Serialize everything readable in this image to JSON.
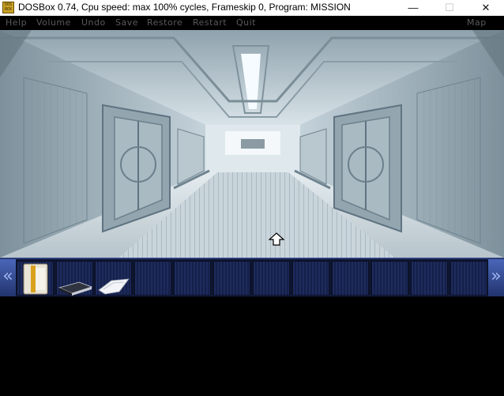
{
  "window": {
    "title": "DOSBox 0.74, Cpu speed: max 100% cycles, Frameskip  0, Program:  MISSION",
    "icon": "dosbox-icon",
    "icon_text": "DOS BOX",
    "minimize": "—",
    "maximize": "☐",
    "close": "✕"
  },
  "menu": {
    "items": [
      "Help",
      "Volume",
      "Undo",
      "Save",
      "Restore",
      "Restart",
      "Quit"
    ],
    "right": "Map"
  },
  "scene": {
    "description_icon": "spaceship-corridor-icon"
  },
  "inventory": {
    "left_arrow": "«",
    "right_arrow": "»",
    "slots": [
      {
        "item": "id-card-icon"
      },
      {
        "item": "book-icon"
      },
      {
        "item": "paper-icon"
      },
      {
        "item": ""
      },
      {
        "item": ""
      },
      {
        "item": ""
      },
      {
        "item": ""
      },
      {
        "item": ""
      },
      {
        "item": ""
      },
      {
        "item": ""
      },
      {
        "item": ""
      },
      {
        "item": ""
      }
    ]
  },
  "cursor": "walk-forward-arrow-icon"
}
